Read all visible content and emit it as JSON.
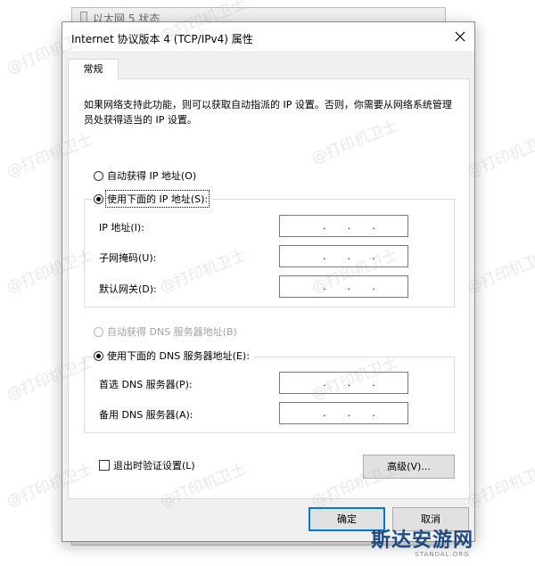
{
  "background_window": {
    "title": "以太网 5 状态"
  },
  "dialog": {
    "title": "Internet 协议版本 4 (TCP/IPv4) 属性",
    "tab": "常规",
    "description": "如果网络支持此功能，则可以获取自动指派的 IP 设置。否则，你需要从网络系统管理员处获得适当的 IP 设置。",
    "ip_section": {
      "auto_label": "自动获得 IP 地址(O)",
      "auto_selected": false,
      "manual_label": "使用下面的 IP 地址(S):",
      "manual_selected": true,
      "fields": [
        {
          "label": "IP 地址(I):",
          "value": ". . ."
        },
        {
          "label": "子网掩码(U):",
          "value": ". . ."
        },
        {
          "label": "默认网关(D):",
          "value": ". . ."
        }
      ]
    },
    "dns_section": {
      "auto_label": "自动获得 DNS 服务器地址(B)",
      "auto_selected": false,
      "auto_disabled": true,
      "manual_label": "使用下面的 DNS 服务器地址(E):",
      "manual_selected": true,
      "fields": [
        {
          "label": "首选 DNS 服务器(P):",
          "value": ". . ."
        },
        {
          "label": "备用 DNS 服务器(A):",
          "value": ". . ."
        }
      ]
    },
    "validate_checkbox": {
      "label": "退出时验证设置(L)",
      "checked": false
    },
    "advanced_button": "高级(V)...",
    "ok_button": "确定",
    "cancel_button": "取消"
  },
  "watermark_text": "@打印机卫士",
  "logo": {
    "text": "斯达安游网",
    "subtext": "STANDAL.ORG"
  },
  "colors": {
    "accent": "#0078d7",
    "dialog_bg": "#f0f0f0",
    "disabled_text": "#a0a0a0",
    "logo": "#1e4b86"
  }
}
